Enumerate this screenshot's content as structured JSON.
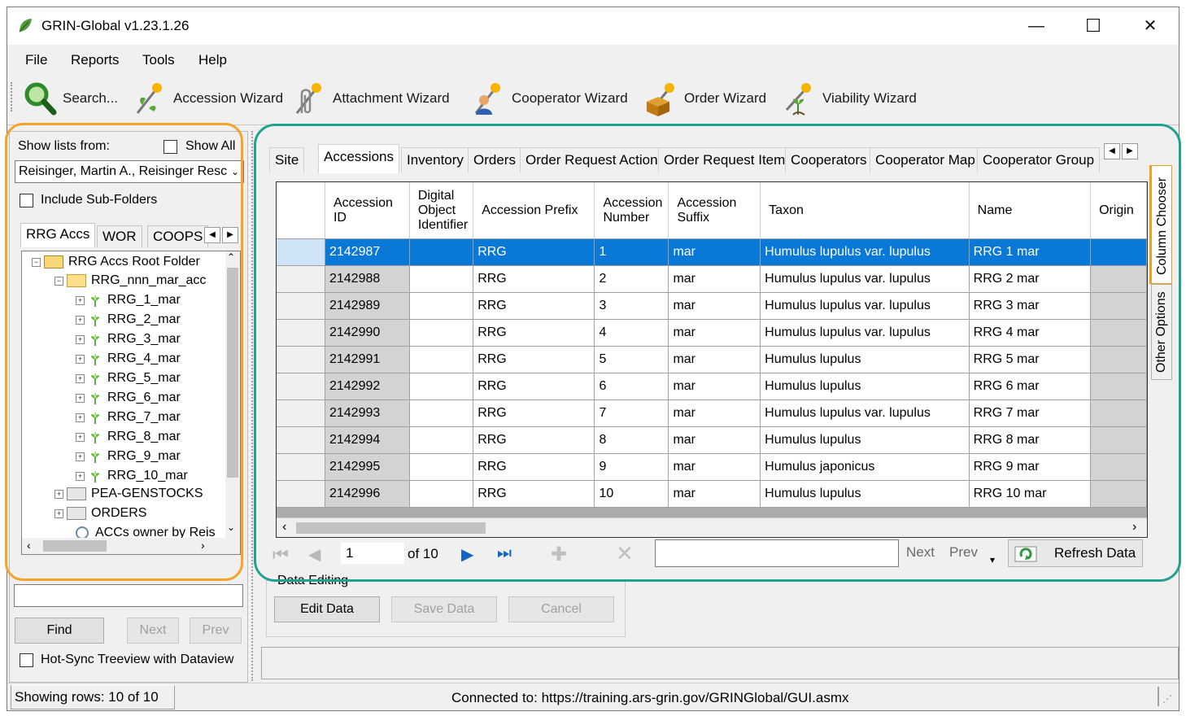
{
  "window": {
    "title": "GRIN-Global v1.23.1.26",
    "minimize": "—",
    "maximize": "☐",
    "close": "✕"
  },
  "menu": [
    "File",
    "Reports",
    "Tools",
    "Help"
  ],
  "toolbar": [
    {
      "label": "Search...",
      "icon": "magnifier-icon"
    },
    {
      "label": "Accession Wizard",
      "icon": "wizard-plant-icon"
    },
    {
      "label": "Attachment Wizard",
      "icon": "wizard-paperclip-icon"
    },
    {
      "label": "Cooperator Wizard",
      "icon": "wizard-person-icon"
    },
    {
      "label": "Order Wizard",
      "icon": "wizard-box-icon"
    },
    {
      "label": "Viability Wizard",
      "icon": "wizard-seedling-icon"
    }
  ],
  "left": {
    "show_lists_from": "Show lists from:",
    "show_all": "Show All",
    "owner_value": "Reisinger, Martin A., Reisinger Resc",
    "include_subfolders": "Include Sub-Folders",
    "tabs": [
      "RRG Accs",
      "WOR",
      "COOPS"
    ],
    "tree": {
      "root": "RRG Accs Root Folder",
      "folder": "RRG_nnn_mar_acc",
      "items": [
        "RRG_1_mar",
        "RRG_2_mar",
        "RRG_3_mar",
        "RRG_4_mar",
        "RRG_5_mar",
        "RRG_6_mar",
        "RRG_7_mar",
        "RRG_8_mar",
        "RRG_9_mar",
        "RRG_10_mar"
      ],
      "folders": [
        "PEA-GENSTOCKS",
        "ORDERS"
      ],
      "query": "ACCs owner by Reis"
    },
    "find_value": "",
    "find": "Find",
    "next": "Next",
    "prev": "Prev",
    "hot_sync": "Hot-Sync Treeview with Dataview"
  },
  "right": {
    "tabs": [
      "Site",
      "Accessions",
      "Inventory",
      "Orders",
      "Order Request Action",
      "Order Request Item",
      "Cooperators",
      "Cooperator Map",
      "Cooperator Group"
    ],
    "columns": [
      "Accession ID",
      "Digital Object Identifier",
      "Accession Prefix",
      "Accession Number",
      "Accession Suffix",
      "Taxon",
      "Name",
      "Origin"
    ],
    "rows": [
      [
        "2142987",
        "",
        "RRG",
        "1",
        "mar",
        "Humulus lupulus var. lupulus",
        "RRG 1 mar",
        ""
      ],
      [
        "2142988",
        "",
        "RRG",
        "2",
        "mar",
        "Humulus lupulus var. lupulus",
        "RRG 2 mar",
        ""
      ],
      [
        "2142989",
        "",
        "RRG",
        "3",
        "mar",
        "Humulus lupulus var. lupulus",
        "RRG 3 mar",
        ""
      ],
      [
        "2142990",
        "",
        "RRG",
        "4",
        "mar",
        "Humulus lupulus var. lupulus",
        "RRG 4 mar",
        ""
      ],
      [
        "2142991",
        "",
        "RRG",
        "5",
        "mar",
        "Humulus lupulus",
        "RRG 5 mar",
        ""
      ],
      [
        "2142992",
        "",
        "RRG",
        "6",
        "mar",
        "Humulus lupulus",
        "RRG 6 mar",
        ""
      ],
      [
        "2142993",
        "",
        "RRG",
        "7",
        "mar",
        "Humulus lupulus var. lupulus",
        "RRG 7 mar",
        ""
      ],
      [
        "2142994",
        "",
        "RRG",
        "8",
        "mar",
        "Humulus lupulus",
        "RRG 8 mar",
        ""
      ],
      [
        "2142995",
        "",
        "RRG",
        "9",
        "mar",
        "Humulus japonicus",
        "RRG 9 mar",
        ""
      ],
      [
        "2142996",
        "",
        "RRG",
        "10",
        "mar",
        "Humulus lupulus",
        "RRG 10 mar",
        ""
      ]
    ],
    "side_tabs": [
      "Column Chooser",
      "Other Options"
    ],
    "nav": {
      "page": "1",
      "of": "of 10",
      "search_value": "",
      "next": "Next",
      "prev": "Prev",
      "refresh": "Refresh Data"
    },
    "data_editing": {
      "group": "Data Editing",
      "edit": "Edit Data",
      "save": "Save Data",
      "cancel": "Cancel"
    }
  },
  "status": {
    "rows": "Showing rows: 10 of 10",
    "connected": "Connected to: https://training.ars-grin.gov/GRINGlobal/GUI.asmx"
  },
  "colors": {
    "selection": "#0a78d7",
    "left_highlight": "#f3a42a",
    "right_highlight": "#21a28c"
  }
}
